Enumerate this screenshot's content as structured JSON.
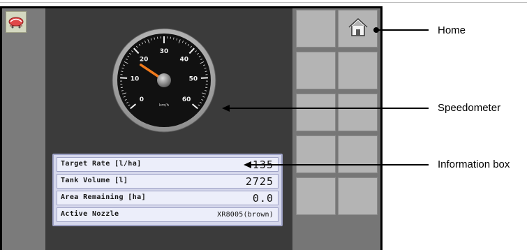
{
  "screen": {
    "app_tab_icon": "sprayer-app-icon",
    "gauge": {
      "unit": "km/h",
      "value": 17,
      "max": 60,
      "tick_labels": [
        "0",
        "10",
        "20",
        "30",
        "40",
        "50",
        "60"
      ]
    },
    "info_box": {
      "rows": [
        {
          "label": "Target Rate [l/ha]",
          "value": "135"
        },
        {
          "label": "Tank Volume [l]",
          "value": "2725"
        },
        {
          "label": "Area Remaining [ha]",
          "value": "0.0"
        },
        {
          "label": "Active Nozzle",
          "value": "XR8005(brown)"
        }
      ]
    },
    "side_buttons": {
      "home_icon": "home-icon"
    }
  },
  "callouts": {
    "home": "Home",
    "speedometer": "Speedometer",
    "information_box": "Information box"
  }
}
